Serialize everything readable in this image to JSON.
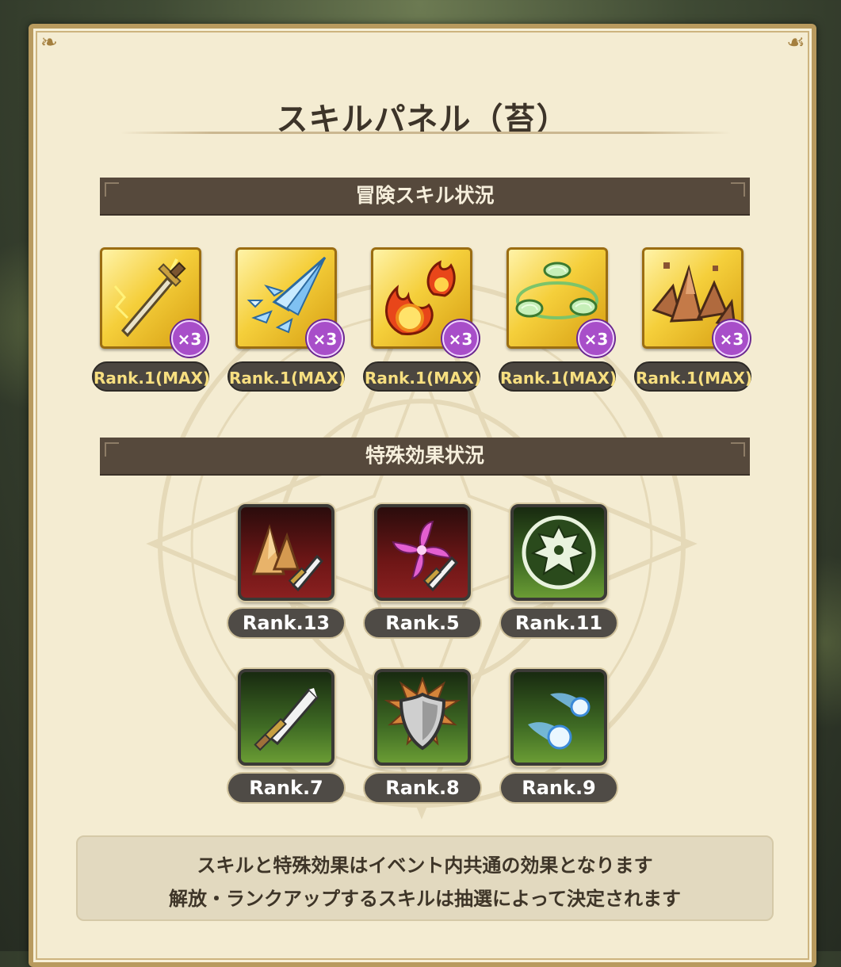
{
  "title": "スキルパネル（苔）",
  "sections": {
    "adventure_skills": "冒険スキル状況",
    "special_effects": "特殊効果状況"
  },
  "adventure_skills": [
    {
      "icon": "lightning-sword-icon",
      "count": "×3",
      "rank": "Rank.1(MAX)"
    },
    {
      "icon": "ice-spear-icon",
      "count": "×3",
      "rank": "Rank.1(MAX)"
    },
    {
      "icon": "fireball-icon",
      "count": "×3",
      "rank": "Rank.1(MAX)"
    },
    {
      "icon": "wind-orbs-icon",
      "count": "×3",
      "rank": "Rank.1(MAX)"
    },
    {
      "icon": "earth-spikes-icon",
      "count": "×3",
      "rank": "Rank.1(MAX)"
    }
  ],
  "special_effects": [
    {
      "icon": "earth-sword-icon",
      "color": "red",
      "rank": "Rank.13"
    },
    {
      "icon": "wind-sword-icon",
      "color": "red",
      "rank": "Rank.5"
    },
    {
      "icon": "dragon-emblem-icon",
      "color": "green",
      "rank": "Rank.11"
    },
    {
      "icon": "sword-icon",
      "color": "green",
      "rank": "Rank.7"
    },
    {
      "icon": "shield-icon",
      "color": "green",
      "rank": "Rank.8"
    },
    {
      "icon": "ice-comet-icon",
      "color": "green",
      "rank": "Rank.9"
    }
  ],
  "notice": {
    "line1": "スキルと特殊効果はイベント内共通の効果となります",
    "line2": "解放・ランクアップするスキルは抽選によって決定されます"
  },
  "colors": {
    "panel": "#f4ecd2",
    "header": "#56493c",
    "gold_tile": "#f5cf3b",
    "badge": "#a84ec9"
  }
}
